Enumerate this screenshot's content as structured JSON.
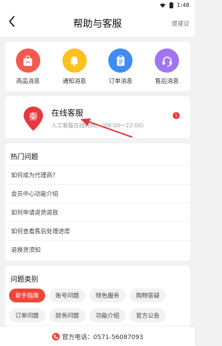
{
  "status_bar": {
    "time": "1:48",
    "wifi_icon": "wifi-icon",
    "battery_icon": "battery-icon"
  },
  "header": {
    "back_icon": "back-arrow-icon",
    "title": "帮助与客服",
    "suggest_label": "提建议"
  },
  "messages": [
    {
      "label": "商品消息",
      "icon": "shopping-bag-icon",
      "color": "#f4584e"
    },
    {
      "label": "通知消息",
      "icon": "bell-icon",
      "color": "#fdc21d"
    },
    {
      "label": "订单消息",
      "icon": "clipboard-icon",
      "color": "#3f8cf4"
    },
    {
      "label": "售后消息",
      "icon": "headset-icon",
      "color": "#a374f2"
    }
  ],
  "online_service": {
    "logo_char": "秦",
    "title": "在线客服",
    "hours": "人工客服在线时间：（09:00～22:00）",
    "badge": "1"
  },
  "hot_questions": {
    "title": "热门问题",
    "items": [
      "如何成为代理商?",
      "会员中心功能介绍",
      "如何申请退货退款",
      "如何查看售后处理进度",
      "退换货须知"
    ]
  },
  "categories": {
    "title": "问题类别",
    "items": [
      "新手指南",
      "账号问题",
      "特色服务",
      "购物答疑",
      "订单问题",
      "财务问题",
      "功能介绍",
      "官方公告"
    ],
    "active_index": 0
  },
  "footer": {
    "phone_icon": "phone-icon",
    "label": "官方电话：0571-56087093"
  },
  "colors": {
    "accent": "#f0453a",
    "background": "#f2f2f2"
  }
}
